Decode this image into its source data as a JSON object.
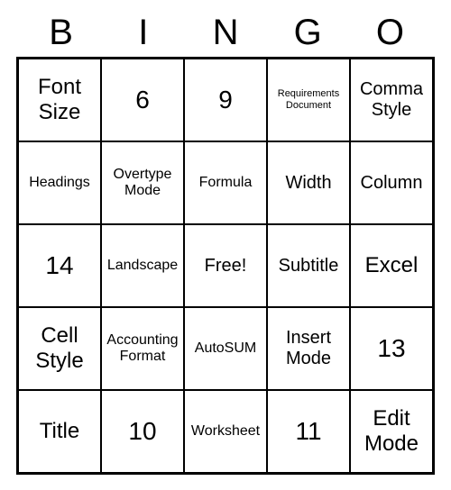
{
  "header": [
    "B",
    "I",
    "N",
    "G",
    "O"
  ],
  "chart_data": {
    "type": "table",
    "title": "BINGO",
    "columns": [
      "B",
      "I",
      "N",
      "G",
      "O"
    ],
    "grid": [
      [
        "Font Size",
        "6",
        "9",
        "Requirements Document",
        "Comma Style"
      ],
      [
        "Headings",
        "Overtype Mode",
        "Formula",
        "Width",
        "Column"
      ],
      [
        "14",
        "Landscape",
        "Free!",
        "Subtitle",
        "Excel"
      ],
      [
        "Cell Style",
        "Accounting Format",
        "AutoSUM",
        "Insert Mode",
        "13"
      ],
      [
        "Title",
        "10",
        "Worksheet",
        "11",
        "Edit Mode"
      ]
    ]
  }
}
